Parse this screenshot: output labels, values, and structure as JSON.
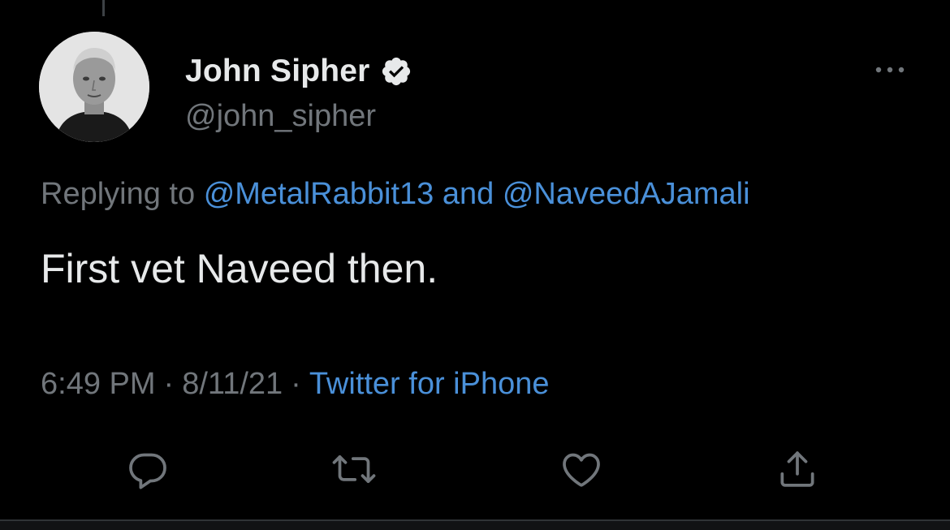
{
  "tweet": {
    "display_name": "John Sipher",
    "handle": "@john_sipher",
    "verified": true,
    "replying_prefix": "Replying to",
    "reply_mentions": [
      "@MetalRabbit13",
      "@NaveedAJamali"
    ],
    "reply_conjunction": "and",
    "text": "First vet Naveed then.",
    "time": "6:49 PM",
    "date": "8/11/21",
    "separator": "·",
    "source": "Twitter for iPhone"
  },
  "icons": {
    "more": "more-horizontal-icon",
    "reply": "reply-icon",
    "retweet": "retweet-icon",
    "like": "heart-icon",
    "share": "share-icon",
    "verified": "verified-badge-icon"
  },
  "colors": {
    "background": "#000000",
    "text_primary": "#e7e9ea",
    "text_secondary": "#71767b",
    "link": "#4a90d9"
  }
}
